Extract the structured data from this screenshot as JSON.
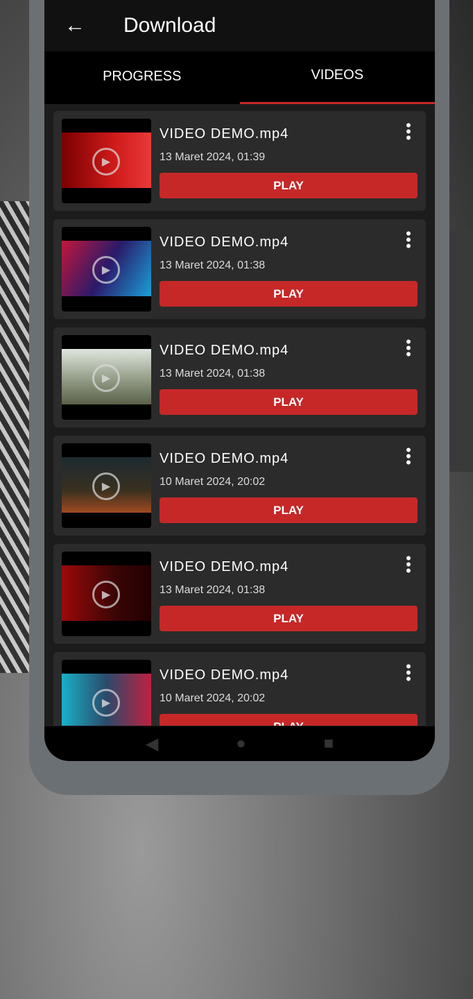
{
  "appbar": {
    "title": "Download"
  },
  "tabs": [
    {
      "label": "PROGRESS",
      "active": false
    },
    {
      "label": "VIDEOS",
      "active": true
    }
  ],
  "accent": "#c62828",
  "videos": [
    {
      "name": "VIDEO DEMO.mp4",
      "date": "13 Maret 2024, 01:39",
      "play": "PLAY",
      "thumb": "linear-gradient(90deg,#7a0000,#d11b1b 60%,#e83a3a)"
    },
    {
      "name": "VIDEO DEMO.mp4",
      "date": "13 Maret 2024, 01:38",
      "play": "PLAY",
      "thumb": "linear-gradient(120deg,#c2173a,#2a1a6a 50%,#1aa0d8)"
    },
    {
      "name": "VIDEO DEMO.mp4",
      "date": "13 Maret 2024, 01:38",
      "play": "PLAY",
      "thumb": "linear-gradient(180deg,#dfe6e0,#9aa38e 50%,#5a6048)"
    },
    {
      "name": "VIDEO DEMO.mp4",
      "date": "10 Maret 2024, 20:02",
      "play": "PLAY",
      "thumb": "linear-gradient(180deg,#1c2a30,#3a3020 60%,#a04a20)"
    },
    {
      "name": "VIDEO DEMO.mp4",
      "date": "13 Maret 2024, 01:38",
      "play": "PLAY",
      "thumb": "linear-gradient(90deg,#9a0a0a,#3a0505 60%,#200)"
    },
    {
      "name": "VIDEO DEMO.mp4",
      "date": "10 Maret 2024, 20:02",
      "play": "PLAY",
      "thumb": "linear-gradient(90deg,#1ab0c8,#2a4a6a 50%,#c02040)"
    }
  ]
}
